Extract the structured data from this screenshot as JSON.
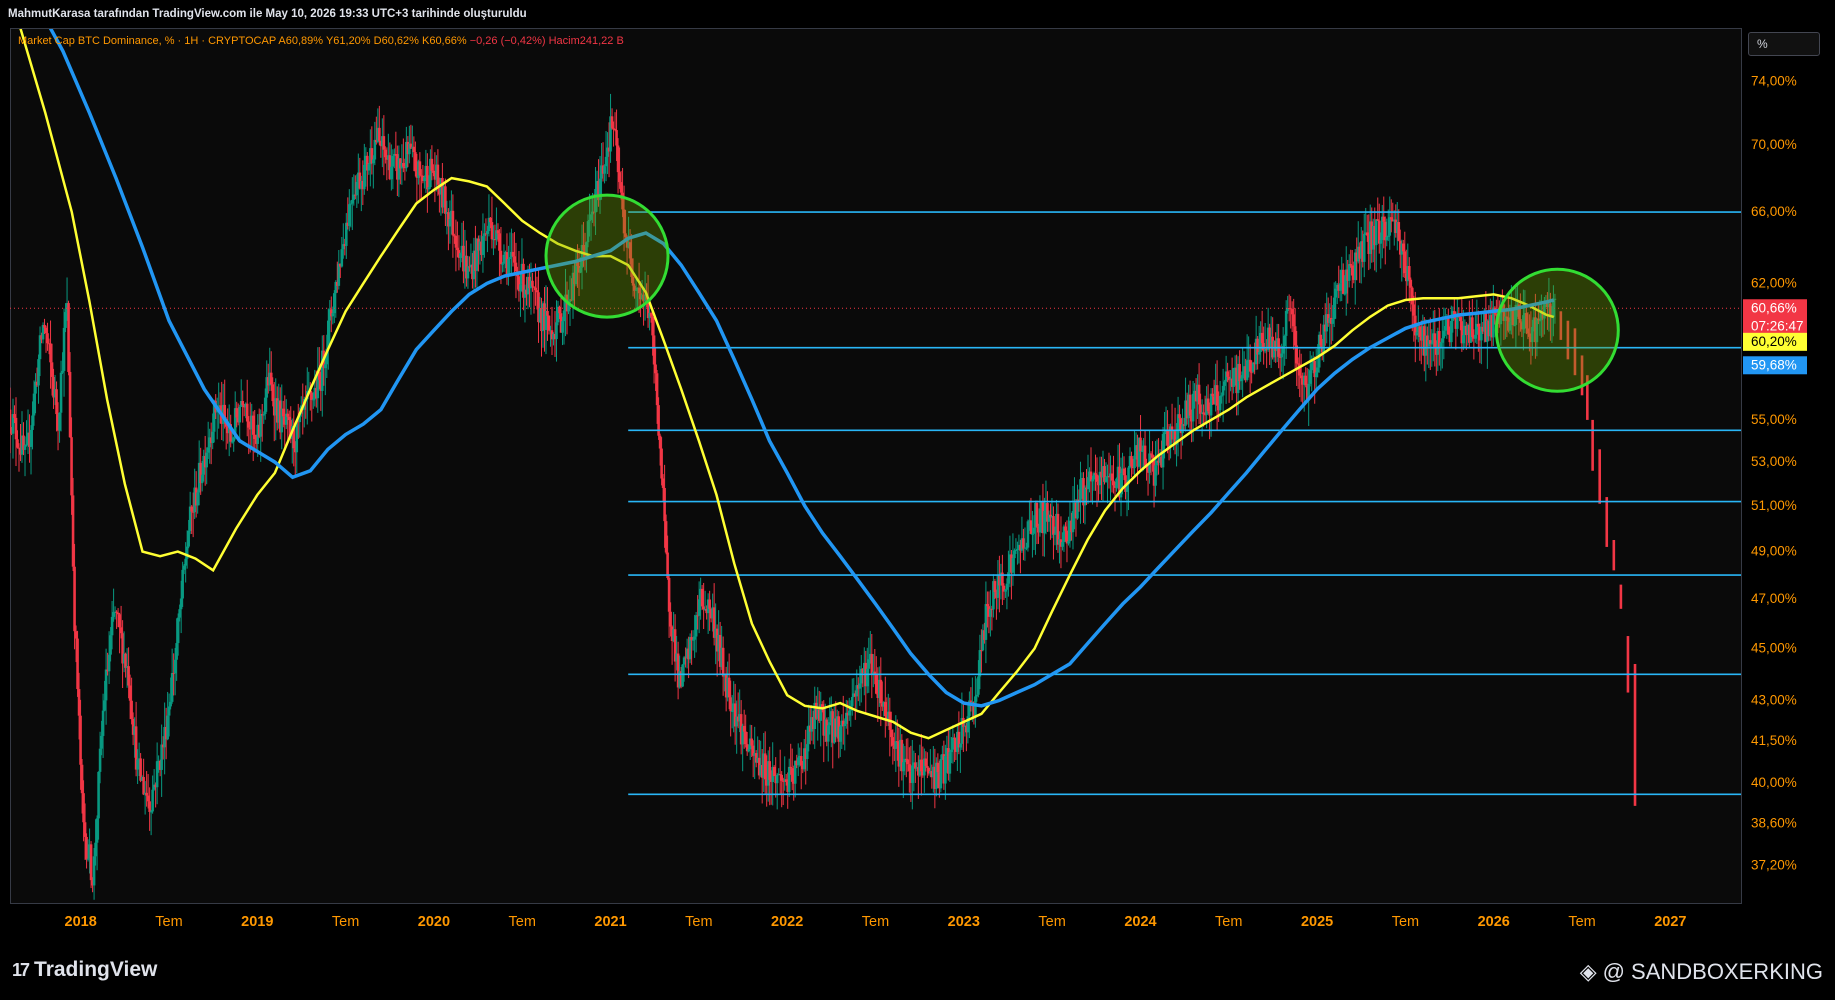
{
  "header": {
    "text": "MahmutKarasa tarafından TradingView.com ile May 10, 2026 19:33 UTC+3 tarihinde oluşturuldu"
  },
  "legend": {
    "symbol": "Market Cap BTC Dominance, % · 1H · CRYPTOCAP",
    "open": "A60,89%",
    "high": "Y61,20%",
    "low": "D60,62%",
    "close": "K60,66%",
    "change": "−0,26 (−0,42%)",
    "volume": "Hacim241,22 B"
  },
  "scale_button": "%",
  "footer": {
    "logo_mark": "17",
    "logo_text": "TradingView",
    "author": "@ SANDBOXERKING",
    "author_icon": "diamond-icon"
  },
  "colors": {
    "up": "#089981",
    "down": "#f23645",
    "ma_fast": "#ffff33",
    "ma_slow": "#2196f3",
    "levels": "#29b6f6",
    "circle": "#33dd33",
    "axis_text": "#ff9800",
    "price_label_bg": "#f23645"
  },
  "chart_data": {
    "type": "candlestick",
    "y_scale": "log",
    "ylim": [
      36.0,
      77.5
    ],
    "xlim": [
      2017.6,
      2027.4
    ],
    "y_ticks": [
      {
        "value": 74.0,
        "label": "74,00%"
      },
      {
        "value": 70.0,
        "label": "70,00%"
      },
      {
        "value": 66.0,
        "label": "66,00%"
      },
      {
        "value": 62.0,
        "label": "62,00%"
      },
      {
        "value": 55.0,
        "label": "55,00%"
      },
      {
        "value": 53.0,
        "label": "53,00%"
      },
      {
        "value": 51.0,
        "label": "51,00%"
      },
      {
        "value": 49.0,
        "label": "49,00%"
      },
      {
        "value": 47.0,
        "label": "47,00%"
      },
      {
        "value": 45.0,
        "label": "45,00%"
      },
      {
        "value": 43.0,
        "label": "43,00%"
      },
      {
        "value": 41.5,
        "label": "41,50%"
      },
      {
        "value": 40.0,
        "label": "40,00%"
      },
      {
        "value": 38.6,
        "label": "38,60%"
      },
      {
        "value": 37.2,
        "label": "37,20%"
      }
    ],
    "x_ticks": [
      {
        "value": 2018.0,
        "label": "2018",
        "major": true
      },
      {
        "value": 2018.5,
        "label": "Tem",
        "major": false
      },
      {
        "value": 2019.0,
        "label": "2019",
        "major": true
      },
      {
        "value": 2019.5,
        "label": "Tem",
        "major": false
      },
      {
        "value": 2020.0,
        "label": "2020",
        "major": true
      },
      {
        "value": 2020.5,
        "label": "Tem",
        "major": false
      },
      {
        "value": 2021.0,
        "label": "2021",
        "major": true
      },
      {
        "value": 2021.5,
        "label": "Tem",
        "major": false
      },
      {
        "value": 2022.0,
        "label": "2022",
        "major": true
      },
      {
        "value": 2022.5,
        "label": "Tem",
        "major": false
      },
      {
        "value": 2023.0,
        "label": "2023",
        "major": true
      },
      {
        "value": 2023.5,
        "label": "Tem",
        "major": false
      },
      {
        "value": 2024.0,
        "label": "2024",
        "major": true
      },
      {
        "value": 2024.5,
        "label": "Tem",
        "major": false
      },
      {
        "value": 2025.0,
        "label": "2025",
        "major": true
      },
      {
        "value": 2025.5,
        "label": "Tem",
        "major": false
      },
      {
        "value": 2026.0,
        "label": "2026",
        "major": true
      },
      {
        "value": 2026.5,
        "label": "Tem",
        "major": false
      },
      {
        "value": 2027.0,
        "label": "2027",
        "major": true
      }
    ],
    "price_anchors": [
      [
        2017.6,
        55.5
      ],
      [
        2017.7,
        53.0
      ],
      [
        2017.8,
        60.0
      ],
      [
        2017.88,
        55.0
      ],
      [
        2017.93,
        61.0
      ],
      [
        2017.97,
        47.0
      ],
      [
        2018.02,
        38.6
      ],
      [
        2018.08,
        36.8
      ],
      [
        2018.14,
        43.0
      ],
      [
        2018.2,
        46.5
      ],
      [
        2018.28,
        44.0
      ],
      [
        2018.33,
        40.5
      ],
      [
        2018.4,
        39.3
      ],
      [
        2018.48,
        41.5
      ],
      [
        2018.55,
        45.0
      ],
      [
        2018.62,
        50.0
      ],
      [
        2018.7,
        53.0
      ],
      [
        2018.78,
        55.8
      ],
      [
        2018.86,
        54.0
      ],
      [
        2018.93,
        56.5
      ],
      [
        2019.0,
        53.5
      ],
      [
        2019.07,
        57.0
      ],
      [
        2019.14,
        55.0
      ],
      [
        2019.22,
        54.0
      ],
      [
        2019.28,
        55.5
      ],
      [
        2019.36,
        56.8
      ],
      [
        2019.42,
        60.0
      ],
      [
        2019.48,
        63.5
      ],
      [
        2019.55,
        67.5
      ],
      [
        2019.62,
        68.5
      ],
      [
        2019.68,
        70.5
      ],
      [
        2019.75,
        69.0
      ],
      [
        2019.8,
        68.5
      ],
      [
        2019.87,
        69.5
      ],
      [
        2019.93,
        68.0
      ],
      [
        2020.0,
        68.5
      ],
      [
        2020.07,
        66.5
      ],
      [
        2020.14,
        64.5
      ],
      [
        2020.2,
        62.5
      ],
      [
        2020.27,
        64.0
      ],
      [
        2020.33,
        65.5
      ],
      [
        2020.38,
        64.0
      ],
      [
        2020.45,
        63.0
      ],
      [
        2020.52,
        62.0
      ],
      [
        2020.58,
        61.0
      ],
      [
        2020.66,
        59.5
      ],
      [
        2020.72,
        60.0
      ],
      [
        2020.78,
        61.5
      ],
      [
        2020.85,
        63.5
      ],
      [
        2020.92,
        66.5
      ],
      [
        2020.98,
        69.5
      ],
      [
        2021.02,
        71.5
      ],
      [
        2021.07,
        66.5
      ],
      [
        2021.12,
        63.0
      ],
      [
        2021.18,
        61.5
      ],
      [
        2021.23,
        60.5
      ],
      [
        2021.28,
        55.0
      ],
      [
        2021.33,
        47.5
      ],
      [
        2021.4,
        43.5
      ],
      [
        2021.46,
        45.0
      ],
      [
        2021.52,
        47.0
      ],
      [
        2021.58,
        46.5
      ],
      [
        2021.65,
        44.0
      ],
      [
        2021.72,
        42.5
      ],
      [
        2021.8,
        41.0
      ],
      [
        2021.88,
        40.5
      ],
      [
        2021.95,
        40.2
      ],
      [
        2022.03,
        40.0
      ],
      [
        2022.1,
        41.0
      ],
      [
        2022.17,
        42.5
      ],
      [
        2022.24,
        42.0
      ],
      [
        2022.32,
        42.0
      ],
      [
        2022.4,
        43.5
      ],
      [
        2022.48,
        44.5
      ],
      [
        2022.55,
        43.0
      ],
      [
        2022.62,
        41.5
      ],
      [
        2022.7,
        40.2
      ],
      [
        2022.78,
        40.6
      ],
      [
        2022.86,
        40.2
      ],
      [
        2022.94,
        41.0
      ],
      [
        2023.0,
        41.8
      ],
      [
        2023.07,
        43.0
      ],
      [
        2023.14,
        46.5
      ],
      [
        2023.2,
        47.5
      ],
      [
        2023.28,
        48.5
      ],
      [
        2023.35,
        49.5
      ],
      [
        2023.42,
        50.5
      ],
      [
        2023.5,
        50.5
      ],
      [
        2023.58,
        49.5
      ],
      [
        2023.66,
        51.5
      ],
      [
        2023.75,
        52.0
      ],
      [
        2023.82,
        52.5
      ],
      [
        2023.9,
        52.0
      ],
      [
        2024.0,
        53.5
      ],
      [
        2024.08,
        52.5
      ],
      [
        2024.16,
        54.0
      ],
      [
        2024.24,
        55.0
      ],
      [
        2024.32,
        56.0
      ],
      [
        2024.4,
        55.5
      ],
      [
        2024.48,
        56.5
      ],
      [
        2024.56,
        57.0
      ],
      [
        2024.64,
        58.0
      ],
      [
        2024.72,
        59.0
      ],
      [
        2024.8,
        58.5
      ],
      [
        2024.86,
        61.0
      ],
      [
        2024.9,
        57.0
      ],
      [
        2024.95,
        56.5
      ],
      [
        2025.0,
        58.0
      ],
      [
        2025.07,
        60.0
      ],
      [
        2025.14,
        62.0
      ],
      [
        2025.22,
        63.0
      ],
      [
        2025.3,
        64.5
      ],
      [
        2025.38,
        65.0
      ],
      [
        2025.45,
        65.5
      ],
      [
        2025.5,
        63.5
      ],
      [
        2025.55,
        60.5
      ],
      [
        2025.6,
        59.0
      ],
      [
        2025.66,
        58.5
      ],
      [
        2025.72,
        59.5
      ],
      [
        2025.78,
        59.8
      ],
      [
        2025.85,
        59.5
      ],
      [
        2025.92,
        59.6
      ],
      [
        2026.0,
        59.8
      ],
      [
        2026.08,
        60.2
      ],
      [
        2026.15,
        60.0
      ],
      [
        2026.22,
        59.5
      ],
      [
        2026.3,
        60.2
      ],
      [
        2026.35,
        60.66
      ]
    ],
    "projection": [
      [
        2026.38,
        60.5,
        59.0
      ],
      [
        2026.42,
        60.0,
        58.0
      ],
      [
        2026.46,
        59.6,
        57.2
      ],
      [
        2026.5,
        58.2,
        56.2
      ],
      [
        2026.53,
        57.2,
        55.0
      ],
      [
        2026.56,
        55.0,
        52.6
      ],
      [
        2026.6,
        53.6,
        51.1
      ],
      [
        2026.64,
        51.4,
        49.2
      ],
      [
        2026.68,
        49.5,
        48.2
      ],
      [
        2026.72,
        47.6,
        46.6
      ],
      [
        2026.76,
        45.5,
        43.3
      ],
      [
        2026.8,
        44.4,
        39.2
      ]
    ],
    "ma_fast": [
      [
        2017.6,
        80.0
      ],
      [
        2017.8,
        72.0
      ],
      [
        2017.95,
        66.0
      ],
      [
        2018.05,
        61.0
      ],
      [
        2018.15,
        56.0
      ],
      [
        2018.25,
        52.0
      ],
      [
        2018.35,
        49.0
      ],
      [
        2018.45,
        48.8
      ],
      [
        2018.55,
        49.0
      ],
      [
        2018.65,
        48.7
      ],
      [
        2018.75,
        48.2
      ],
      [
        2018.88,
        50.0
      ],
      [
        2019.0,
        51.5
      ],
      [
        2019.1,
        52.5
      ],
      [
        2019.2,
        54.5
      ],
      [
        2019.3,
        56.5
      ],
      [
        2019.4,
        58.5
      ],
      [
        2019.5,
        60.5
      ],
      [
        2019.6,
        62.0
      ],
      [
        2019.7,
        63.5
      ],
      [
        2019.8,
        65.0
      ],
      [
        2019.9,
        66.5
      ],
      [
        2020.0,
        67.3
      ],
      [
        2020.1,
        68.0
      ],
      [
        2020.2,
        67.8
      ],
      [
        2020.3,
        67.5
      ],
      [
        2020.4,
        66.5
      ],
      [
        2020.5,
        65.5
      ],
      [
        2020.6,
        64.8
      ],
      [
        2020.7,
        64.2
      ],
      [
        2020.8,
        63.8
      ],
      [
        2020.9,
        63.5
      ],
      [
        2021.0,
        63.5
      ],
      [
        2021.1,
        63.0
      ],
      [
        2021.2,
        61.5
      ],
      [
        2021.3,
        59.0
      ],
      [
        2021.4,
        56.5
      ],
      [
        2021.5,
        54.0
      ],
      [
        2021.6,
        51.5
      ],
      [
        2021.7,
        48.5
      ],
      [
        2021.8,
        46.0
      ],
      [
        2021.9,
        44.5
      ],
      [
        2022.0,
        43.2
      ],
      [
        2022.1,
        42.8
      ],
      [
        2022.2,
        42.7
      ],
      [
        2022.3,
        42.9
      ],
      [
        2022.4,
        42.6
      ],
      [
        2022.5,
        42.4
      ],
      [
        2022.6,
        42.2
      ],
      [
        2022.7,
        41.8
      ],
      [
        2022.8,
        41.6
      ],
      [
        2022.9,
        41.9
      ],
      [
        2023.0,
        42.2
      ],
      [
        2023.1,
        42.5
      ],
      [
        2023.2,
        43.3
      ],
      [
        2023.3,
        44.1
      ],
      [
        2023.4,
        45.0
      ],
      [
        2023.5,
        46.5
      ],
      [
        2023.6,
        48.0
      ],
      [
        2023.7,
        49.5
      ],
      [
        2023.8,
        50.8
      ],
      [
        2023.9,
        51.8
      ],
      [
        2024.0,
        52.6
      ],
      [
        2024.1,
        53.3
      ],
      [
        2024.2,
        53.9
      ],
      [
        2024.3,
        54.5
      ],
      [
        2024.4,
        55.0
      ],
      [
        2024.5,
        55.5
      ],
      [
        2024.6,
        56.1
      ],
      [
        2024.7,
        56.6
      ],
      [
        2024.8,
        57.1
      ],
      [
        2024.9,
        57.6
      ],
      [
        2025.0,
        58.1
      ],
      [
        2025.1,
        58.7
      ],
      [
        2025.2,
        59.5
      ],
      [
        2025.3,
        60.2
      ],
      [
        2025.4,
        60.8
      ],
      [
        2025.5,
        61.1
      ],
      [
        2025.6,
        61.2
      ],
      [
        2025.7,
        61.2
      ],
      [
        2025.8,
        61.2
      ],
      [
        2025.9,
        61.3
      ],
      [
        2026.0,
        61.4
      ],
      [
        2026.1,
        61.2
      ],
      [
        2026.2,
        60.8
      ],
      [
        2026.3,
        60.3
      ],
      [
        2026.34,
        60.2
      ]
    ],
    "ma_slow": [
      [
        2017.72,
        80.0
      ],
      [
        2017.9,
        76.0
      ],
      [
        2018.05,
        72.0
      ],
      [
        2018.2,
        68.0
      ],
      [
        2018.35,
        64.0
      ],
      [
        2018.5,
        60.0
      ],
      [
        2018.7,
        56.5
      ],
      [
        2018.9,
        54.0
      ],
      [
        2019.1,
        53.0
      ],
      [
        2019.2,
        52.3
      ],
      [
        2019.3,
        52.6
      ],
      [
        2019.4,
        53.6
      ],
      [
        2019.5,
        54.3
      ],
      [
        2019.6,
        54.8
      ],
      [
        2019.7,
        55.5
      ],
      [
        2019.8,
        57.0
      ],
      [
        2019.9,
        58.5
      ],
      [
        2020.0,
        59.5
      ],
      [
        2020.1,
        60.5
      ],
      [
        2020.2,
        61.4
      ],
      [
        2020.3,
        62.0
      ],
      [
        2020.4,
        62.4
      ],
      [
        2020.5,
        62.6
      ],
      [
        2020.6,
        62.8
      ],
      [
        2020.7,
        63.0
      ],
      [
        2020.8,
        63.2
      ],
      [
        2020.9,
        63.5
      ],
      [
        2021.0,
        63.8
      ],
      [
        2021.1,
        64.5
      ],
      [
        2021.2,
        64.8
      ],
      [
        2021.3,
        64.2
      ],
      [
        2021.4,
        63.0
      ],
      [
        2021.5,
        61.5
      ],
      [
        2021.6,
        60.0
      ],
      [
        2021.7,
        58.0
      ],
      [
        2021.8,
        56.0
      ],
      [
        2021.9,
        54.0
      ],
      [
        2022.0,
        52.5
      ],
      [
        2022.1,
        51.0
      ],
      [
        2022.2,
        49.8
      ],
      [
        2022.3,
        48.8
      ],
      [
        2022.4,
        47.8
      ],
      [
        2022.5,
        46.8
      ],
      [
        2022.6,
        45.8
      ],
      [
        2022.7,
        44.8
      ],
      [
        2022.8,
        44.0
      ],
      [
        2022.9,
        43.3
      ],
      [
        2023.0,
        42.9
      ],
      [
        2023.1,
        42.8
      ],
      [
        2023.2,
        43.0
      ],
      [
        2023.3,
        43.3
      ],
      [
        2023.4,
        43.6
      ],
      [
        2023.5,
        44.0
      ],
      [
        2023.6,
        44.4
      ],
      [
        2023.7,
        45.2
      ],
      [
        2023.8,
        46.0
      ],
      [
        2023.9,
        46.8
      ],
      [
        2024.0,
        47.5
      ],
      [
        2024.1,
        48.3
      ],
      [
        2024.2,
        49.1
      ],
      [
        2024.3,
        49.9
      ],
      [
        2024.4,
        50.7
      ],
      [
        2024.5,
        51.6
      ],
      [
        2024.6,
        52.5
      ],
      [
        2024.7,
        53.5
      ],
      [
        2024.8,
        54.5
      ],
      [
        2024.9,
        55.5
      ],
      [
        2025.0,
        56.5
      ],
      [
        2025.1,
        57.3
      ],
      [
        2025.2,
        58.0
      ],
      [
        2025.3,
        58.6
      ],
      [
        2025.4,
        59.1
      ],
      [
        2025.5,
        59.6
      ],
      [
        2025.6,
        59.9
      ],
      [
        2025.7,
        60.1
      ],
      [
        2025.8,
        60.3
      ],
      [
        2025.9,
        60.4
      ],
      [
        2026.0,
        60.5
      ],
      [
        2026.1,
        60.6
      ],
      [
        2026.2,
        60.8
      ],
      [
        2026.3,
        61.0
      ],
      [
        2026.34,
        61.1
      ]
    ],
    "horizontal_levels": [
      {
        "y": 66.0,
        "x_start": 2021.1
      },
      {
        "y": 58.6,
        "x_start": 2021.1
      },
      {
        "y": 54.5,
        "x_start": 2021.1
      },
      {
        "y": 51.2,
        "x_start": 2021.1
      },
      {
        "y": 48.0,
        "x_start": 2021.1
      },
      {
        "y": 44.0,
        "x_start": 2021.1
      },
      {
        "y": 39.6,
        "x_start": 2021.1
      }
    ],
    "circles": [
      {
        "x": 2020.98,
        "y": 63.5
      },
      {
        "x": 2026.36,
        "y": 59.5
      }
    ],
    "price_labels": [
      {
        "value": 60.66,
        "text": "60,66%",
        "sub": "07:26:47",
        "color": "#f23645",
        "text_color": "#ffffff"
      },
      {
        "value": 58.9,
        "text": "60,20%",
        "color": "#ffff33",
        "text_color": "#000000"
      },
      {
        "value": 57.7,
        "text": "59,68%",
        "color": "#2196f3",
        "text_color": "#ffffff"
      }
    ]
  }
}
